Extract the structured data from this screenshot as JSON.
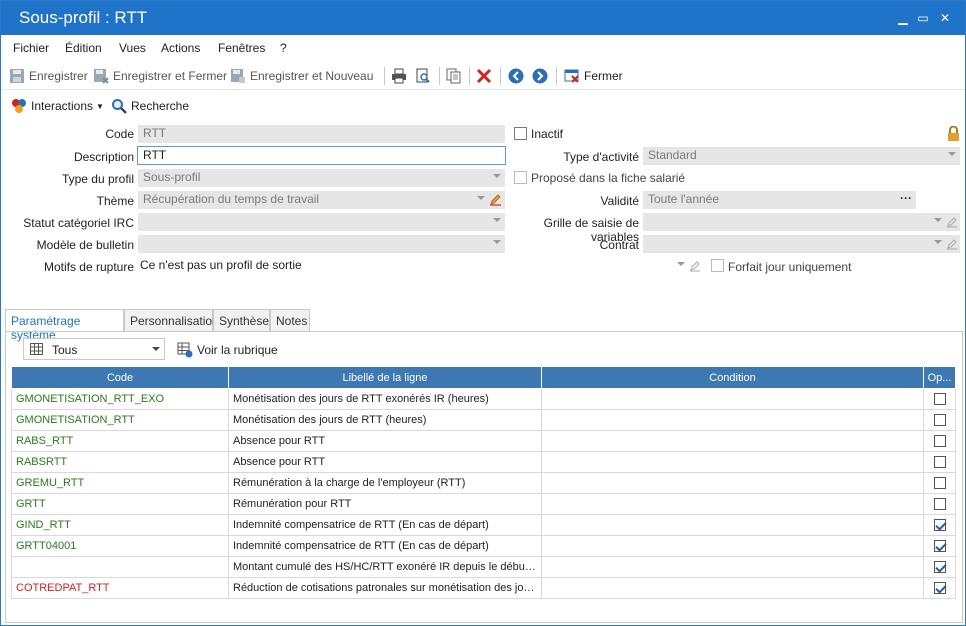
{
  "window": {
    "title": "Sous-profil : RTT",
    "min": "▁",
    "max": "▭",
    "close": "✕"
  },
  "menu": [
    "Fichier",
    "Édition",
    "Vues",
    "Actions",
    "Fenêtres",
    "?"
  ],
  "toolbar": {
    "save": "Enregistrer",
    "save_close": "Enregistrer et Fermer",
    "save_new": "Enregistrer et Nouveau",
    "close": "Fermer"
  },
  "toolbar2": {
    "interactions": "Interactions",
    "search": "Recherche"
  },
  "form": {
    "code_label": "Code",
    "code_value": "RTT",
    "inactive_label": "Inactif",
    "description_label": "Description",
    "description_value": "RTT",
    "activity_label": "Type d'activité",
    "activity_value": "Standard",
    "profile_type_label": "Type du profil",
    "profile_type_value": "Sous-profil",
    "proposed_label": "Proposé dans la fiche salarié",
    "theme_label": "Thème",
    "theme_value": "Récupération du temps de travail",
    "validity_label": "Validité",
    "validity_value": "Toute l'année",
    "validity_more": "···",
    "irc_label": "Statut catégoriel IRC",
    "irc_value": "",
    "variables_label": "Grille de saisie de variables",
    "variables_value": "",
    "bulletin_label": "Modèle de bulletin",
    "bulletin_value": "",
    "contract_label": "Contrat",
    "contract_value": "",
    "rupture_label": "Motifs de rupture",
    "rupture_value": "Ce n'est pas un profil de sortie",
    "forfait_label": "Forfait jour uniquement"
  },
  "tabs": [
    "Paramétrage système",
    "Personnalisation",
    "Synthèse",
    "Notes"
  ],
  "filter": {
    "value": "Tous",
    "view_label": "Voir la rubrique"
  },
  "table": {
    "headers": [
      "Code",
      "Libellé de la ligne",
      "Condition",
      "Op..."
    ],
    "rows": [
      {
        "code": "GMONETISATION_RTT_EXO",
        "label": "Monétisation des jours de RTT exonérés IR (heures)",
        "condition": "",
        "checked": false,
        "red": false
      },
      {
        "code": "GMONETISATION_RTT",
        "label": "Monétisation des jours de RTT (heures)",
        "condition": "",
        "checked": false,
        "red": false
      },
      {
        "code": "RABS_RTT",
        "label": "Absence pour RTT",
        "condition": "",
        "checked": false,
        "red": false
      },
      {
        "code": "RABSRTT",
        "label": "Absence pour RTT",
        "condition": "",
        "checked": false,
        "red": false
      },
      {
        "code": "GREMU_RTT",
        "label": "Rémunération à la charge de l'employeur (RTT)",
        "condition": "",
        "checked": false,
        "red": false
      },
      {
        "code": "GRTT",
        "label": "Rémunération pour RTT",
        "condition": "",
        "checked": false,
        "red": false
      },
      {
        "code": "GIND_RTT",
        "label": "Indemnité compensatrice de RTT (En cas de départ)",
        "condition": "",
        "checked": true,
        "red": false
      },
      {
        "code": "GRTT04001",
        "label": "Indemnité compensatrice de RTT (En cas de départ)",
        "condition": "",
        "checked": true,
        "red": false
      },
      {
        "code": "",
        "label": "Montant cumulé des HS/HC/RTT exonéré IR depuis le début d...",
        "condition": "",
        "checked": true,
        "red": false
      },
      {
        "code": "COTREDPAT_RTT",
        "label": "Réduction de cotisations patronales sur monétisation des jour...",
        "condition": "",
        "checked": true,
        "red": true
      }
    ]
  }
}
